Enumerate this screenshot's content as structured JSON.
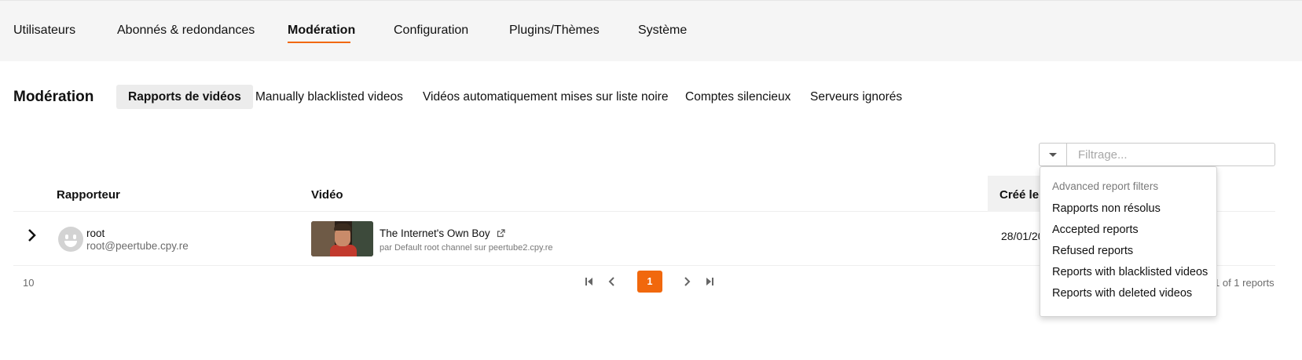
{
  "top_nav": {
    "items": [
      {
        "label": "Utilisateurs",
        "active": false
      },
      {
        "label": "Abonnés & redondances",
        "active": false
      },
      {
        "label": "Modération",
        "active": true
      },
      {
        "label": "Configuration",
        "active": false
      },
      {
        "label": "Plugins/Thèmes",
        "active": false
      },
      {
        "label": "Système",
        "active": false
      }
    ],
    "accent_color": "#f1680d"
  },
  "page": {
    "title": "Modération",
    "tabs": [
      {
        "label": "Rapports de vidéos",
        "active": true
      },
      {
        "label": "Manually blacklisted videos",
        "active": false
      },
      {
        "label": "Vidéos automatiquement mises sur liste noire",
        "active": false
      },
      {
        "label": "Comptes silencieux",
        "active": false
      },
      {
        "label": "Serveurs ignorés",
        "active": false
      }
    ]
  },
  "filter": {
    "placeholder": "Filtrage...",
    "value": "",
    "dropdown": {
      "header": "Advanced report filters",
      "items": [
        "Rapports non résolus",
        "Accepted reports",
        "Refused reports",
        "Reports with blacklisted videos",
        "Reports with deleted videos"
      ]
    }
  },
  "table": {
    "columns": {
      "reporter": "Rapporteur",
      "video": "Vidéo",
      "created": "Créé le"
    },
    "rows": [
      {
        "reporter_name": "root",
        "reporter_handle": "root@peertube.cpy.re",
        "video_title": "The Internet's Own Boy",
        "video_subtitle": "par Default root channel sur peertube2.cpy.re",
        "created": "28/01/20"
      }
    ]
  },
  "pagination": {
    "rows_per_page": "10",
    "current_page": "1",
    "summary": "1 of 1 reports"
  }
}
